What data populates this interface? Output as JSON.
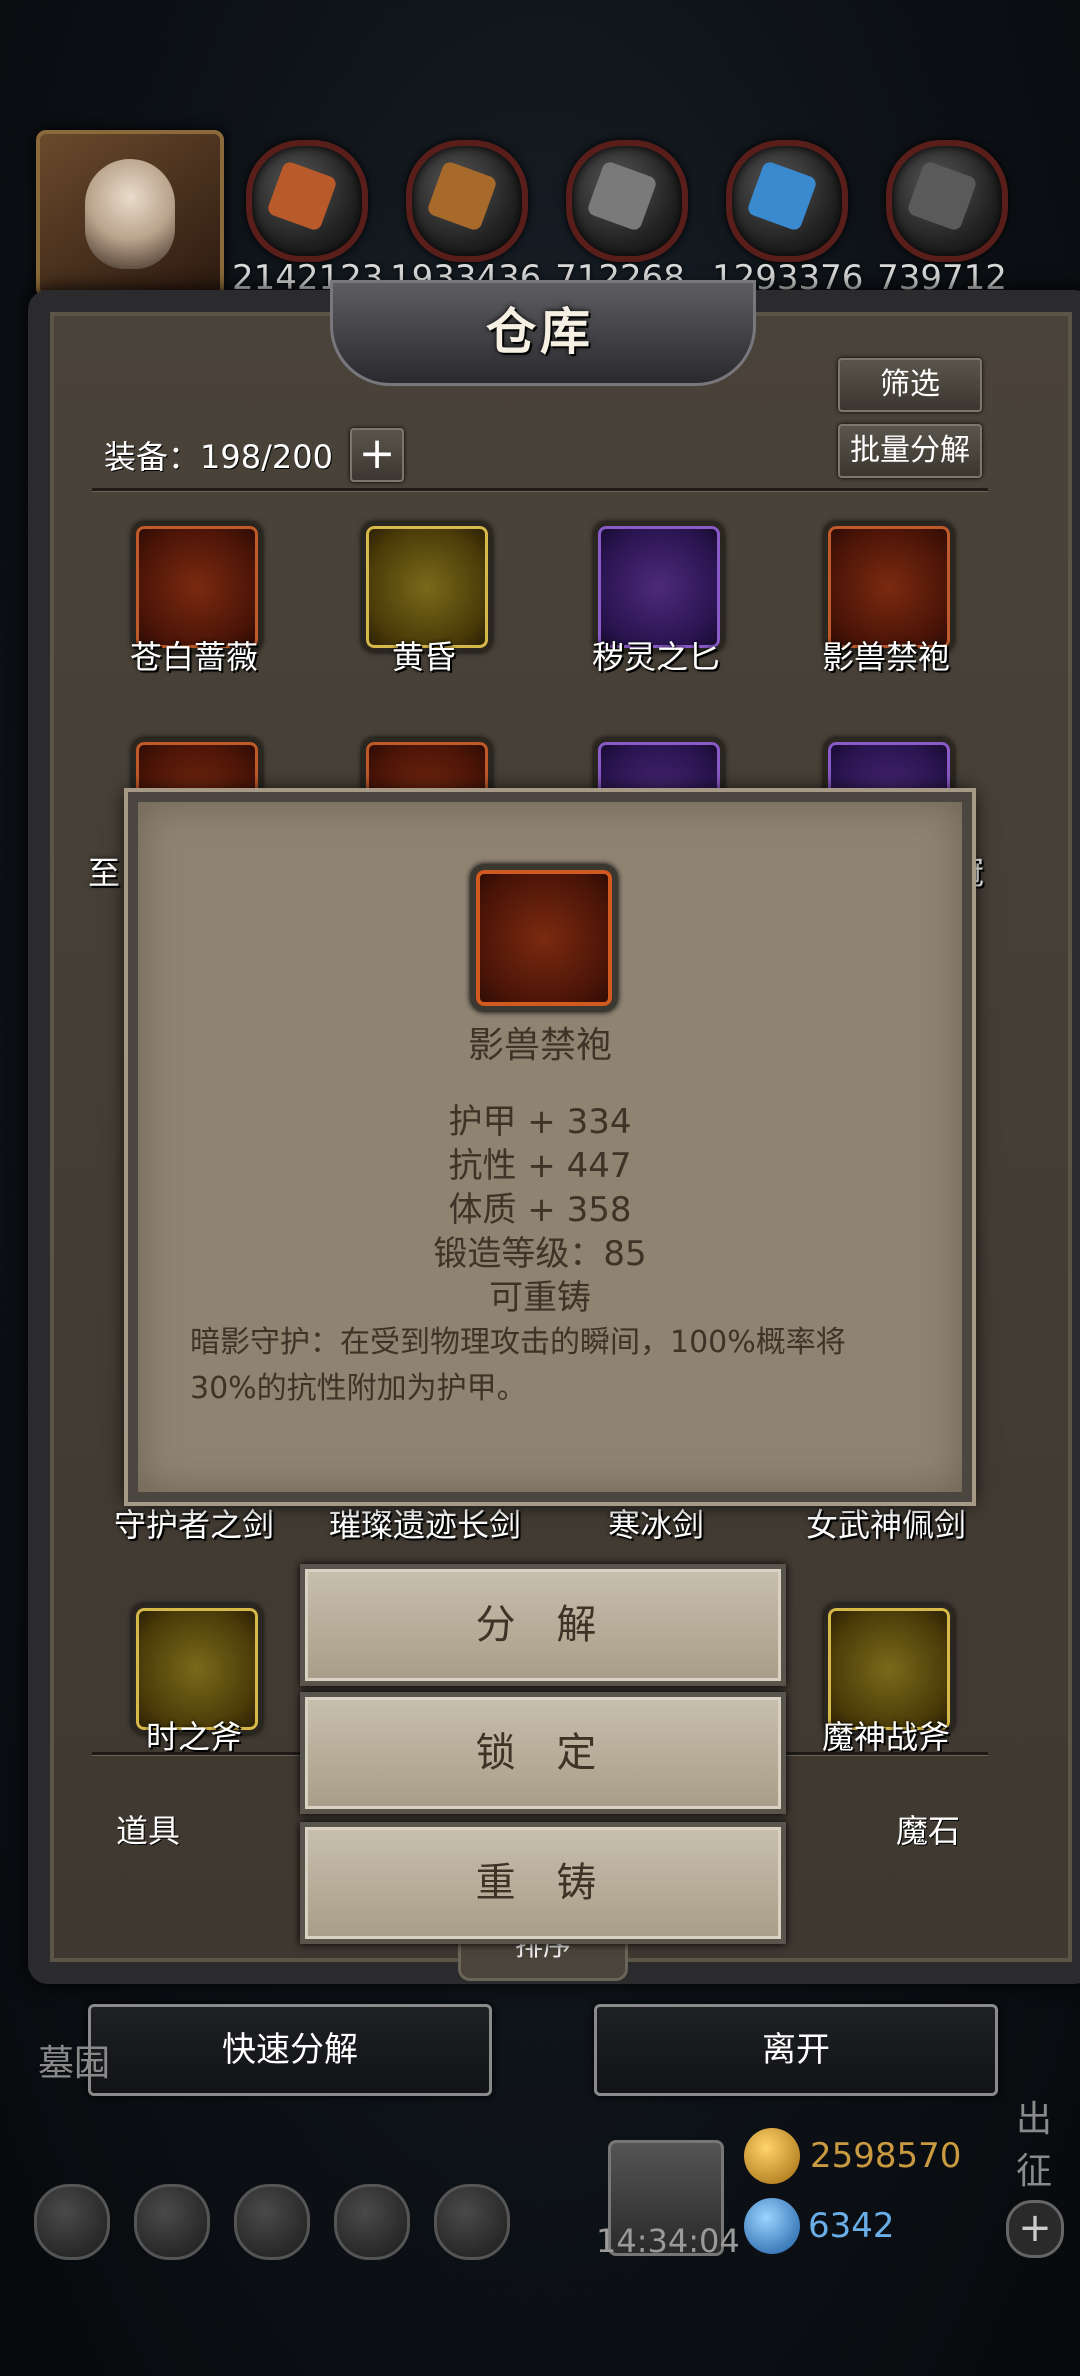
{
  "resources": [
    {
      "icon": "meat-icon",
      "value": "2142123",
      "color": "#b85a2a"
    },
    {
      "icon": "wood-icon",
      "value": "1933436",
      "color": "#a86a2a"
    },
    {
      "icon": "stone-icon",
      "value": "712268",
      "color": "#7a7a7a"
    },
    {
      "icon": "crystal-icon",
      "value": "1293376",
      "color": "#3a8ad0"
    },
    {
      "icon": "iron-icon",
      "value": "739712",
      "color": "#5a5a5a"
    }
  ],
  "warehouse": {
    "title": "仓库",
    "filter_label": "筛选",
    "batch_dismantle_label": "批量分解",
    "equip_count": "装备：198/200",
    "plus_label": "+",
    "items": [
      {
        "name": "苍白蔷薇",
        "icon": "sword-icon"
      },
      {
        "name": "黄昏",
        "icon": "axe-icon"
      },
      {
        "name": "秽灵之匕",
        "icon": "dagger-icon"
      },
      {
        "name": "影兽禁袍",
        "icon": "robe-icon"
      },
      {
        "name": "至",
        "icon": "helmet-icon"
      },
      {
        "name": "冠",
        "icon": "crown-icon"
      },
      {
        "name": "守护者之剑",
        "icon": "sword-icon"
      },
      {
        "name": "璀璨遗迹长剑",
        "icon": "sword-icon"
      },
      {
        "name": "寒冰剑",
        "icon": "sword-icon"
      },
      {
        "name": "女武神佩剑",
        "icon": "sword-icon"
      },
      {
        "name": "时之斧",
        "icon": "axe-icon"
      },
      {
        "name": "魔神战斧",
        "icon": "axe-icon"
      }
    ],
    "tabs": {
      "left": "道具",
      "right": "魔石"
    },
    "sort_label": "排序"
  },
  "item_detail": {
    "name": "影兽禁袍",
    "stats": [
      "护甲 + 334",
      "抗性 + 447",
      "体质 + 358",
      "锻造等级：85",
      "可重铸"
    ],
    "description": "暗影守护：在受到物理攻击的瞬间，100%概率将30%的抗性附加为护甲。"
  },
  "actions": {
    "dismantle": "分 解",
    "lock": "锁 定",
    "reforge": "重 铸"
  },
  "bottom": {
    "quick_dismantle": "快速分解",
    "leave": "离开",
    "left_partial": "墓园",
    "right_partial": "出征",
    "gold": "2598570",
    "gems": "6342",
    "time": "14:34:04",
    "add_label": "+"
  }
}
